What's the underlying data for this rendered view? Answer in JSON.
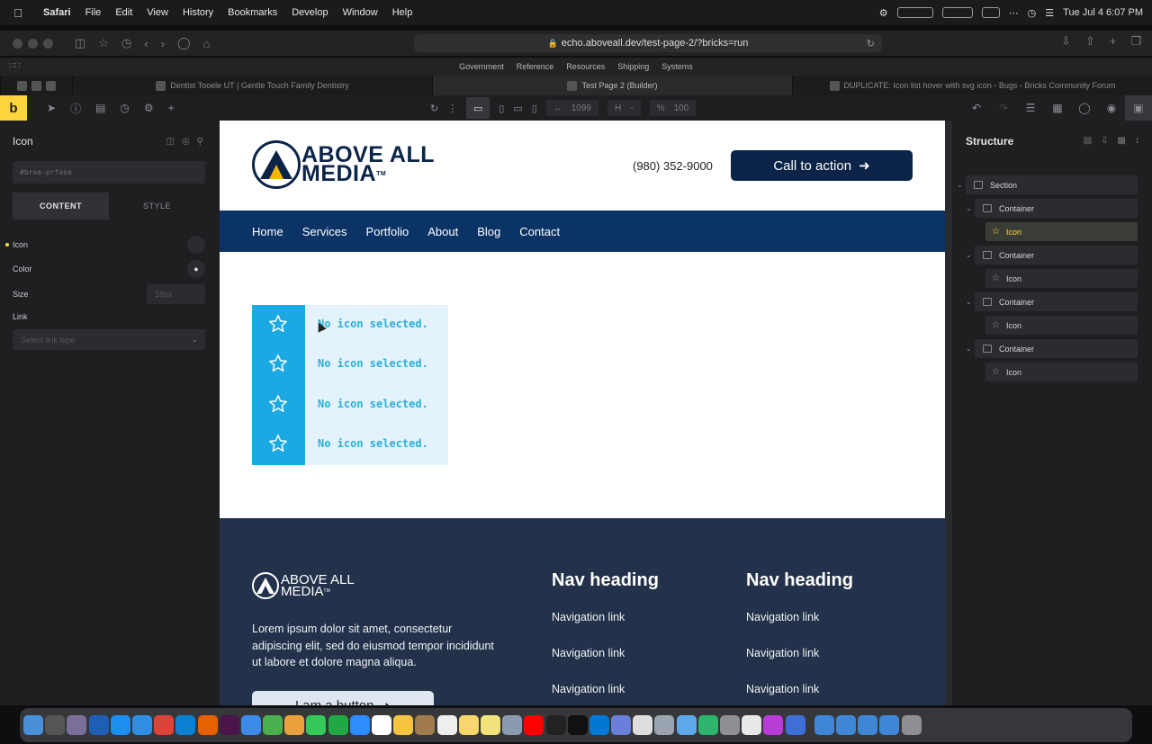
{
  "menubar": {
    "app": "Safari",
    "items": [
      "File",
      "Edit",
      "View",
      "History",
      "Bookmarks",
      "Develop",
      "Window",
      "Help"
    ],
    "datetime": "Tue Jul 4  6:07 PM"
  },
  "browser": {
    "url": "echo.aboveall.dev/test-page-2/?bricks=run",
    "favorites": [
      "Government",
      "Reference",
      "Resources",
      "Shipping",
      "Systems"
    ],
    "tabs": [
      "Dentist Tooele UT | Gentle Touch Family Dentistry",
      "Test Page 2 (Builder)",
      "DUPLICATE: Icon list hover with svg icon - Bugs - Bricks Community Forum"
    ]
  },
  "builder": {
    "logo": "b",
    "width_label": "1099",
    "height_label": "H",
    "height_value": "-",
    "zoom_label": "%",
    "zoom_value": "100"
  },
  "left_panel": {
    "title": "Icon",
    "css_id": "#brxe-prfase",
    "tab_content": "CONTENT",
    "tab_style": "STYLE",
    "icon_label": "Icon",
    "color_label": "Color",
    "size_label": "Size",
    "size_placeholder": "16px",
    "link_label": "Link",
    "link_placeholder": "Select link type"
  },
  "site": {
    "logo_top": "ABOVE ALL",
    "logo_bottom": "MEDIA",
    "logo_tm": "TM",
    "phone": "(980) 352-9000",
    "cta": "Call to action",
    "nav": [
      "Home",
      "Services",
      "Portfolio",
      "About",
      "Blog",
      "Contact"
    ],
    "icon_message": "No icon selected.",
    "footer_text": "Lorem ipsum dolor sit amet, consectetur adipiscing elit, sed do eiusmod tempor incididunt ut labore et dolore magna aliqua.",
    "footer_button": "I am a button",
    "nav_heading_1": "Nav heading",
    "nav_heading_2": "Nav heading",
    "nav_link": "Navigation link"
  },
  "structure": {
    "title": "Structure",
    "section": "Section",
    "container": "Container",
    "icon": "Icon"
  },
  "colors": {
    "navy": "#0b2447",
    "nav_blue": "#0b3366",
    "icon_blue": "#1ba9e3",
    "icon_bg": "#e4f2fb",
    "footer": "#23324a",
    "accent": "#ffd53e"
  }
}
